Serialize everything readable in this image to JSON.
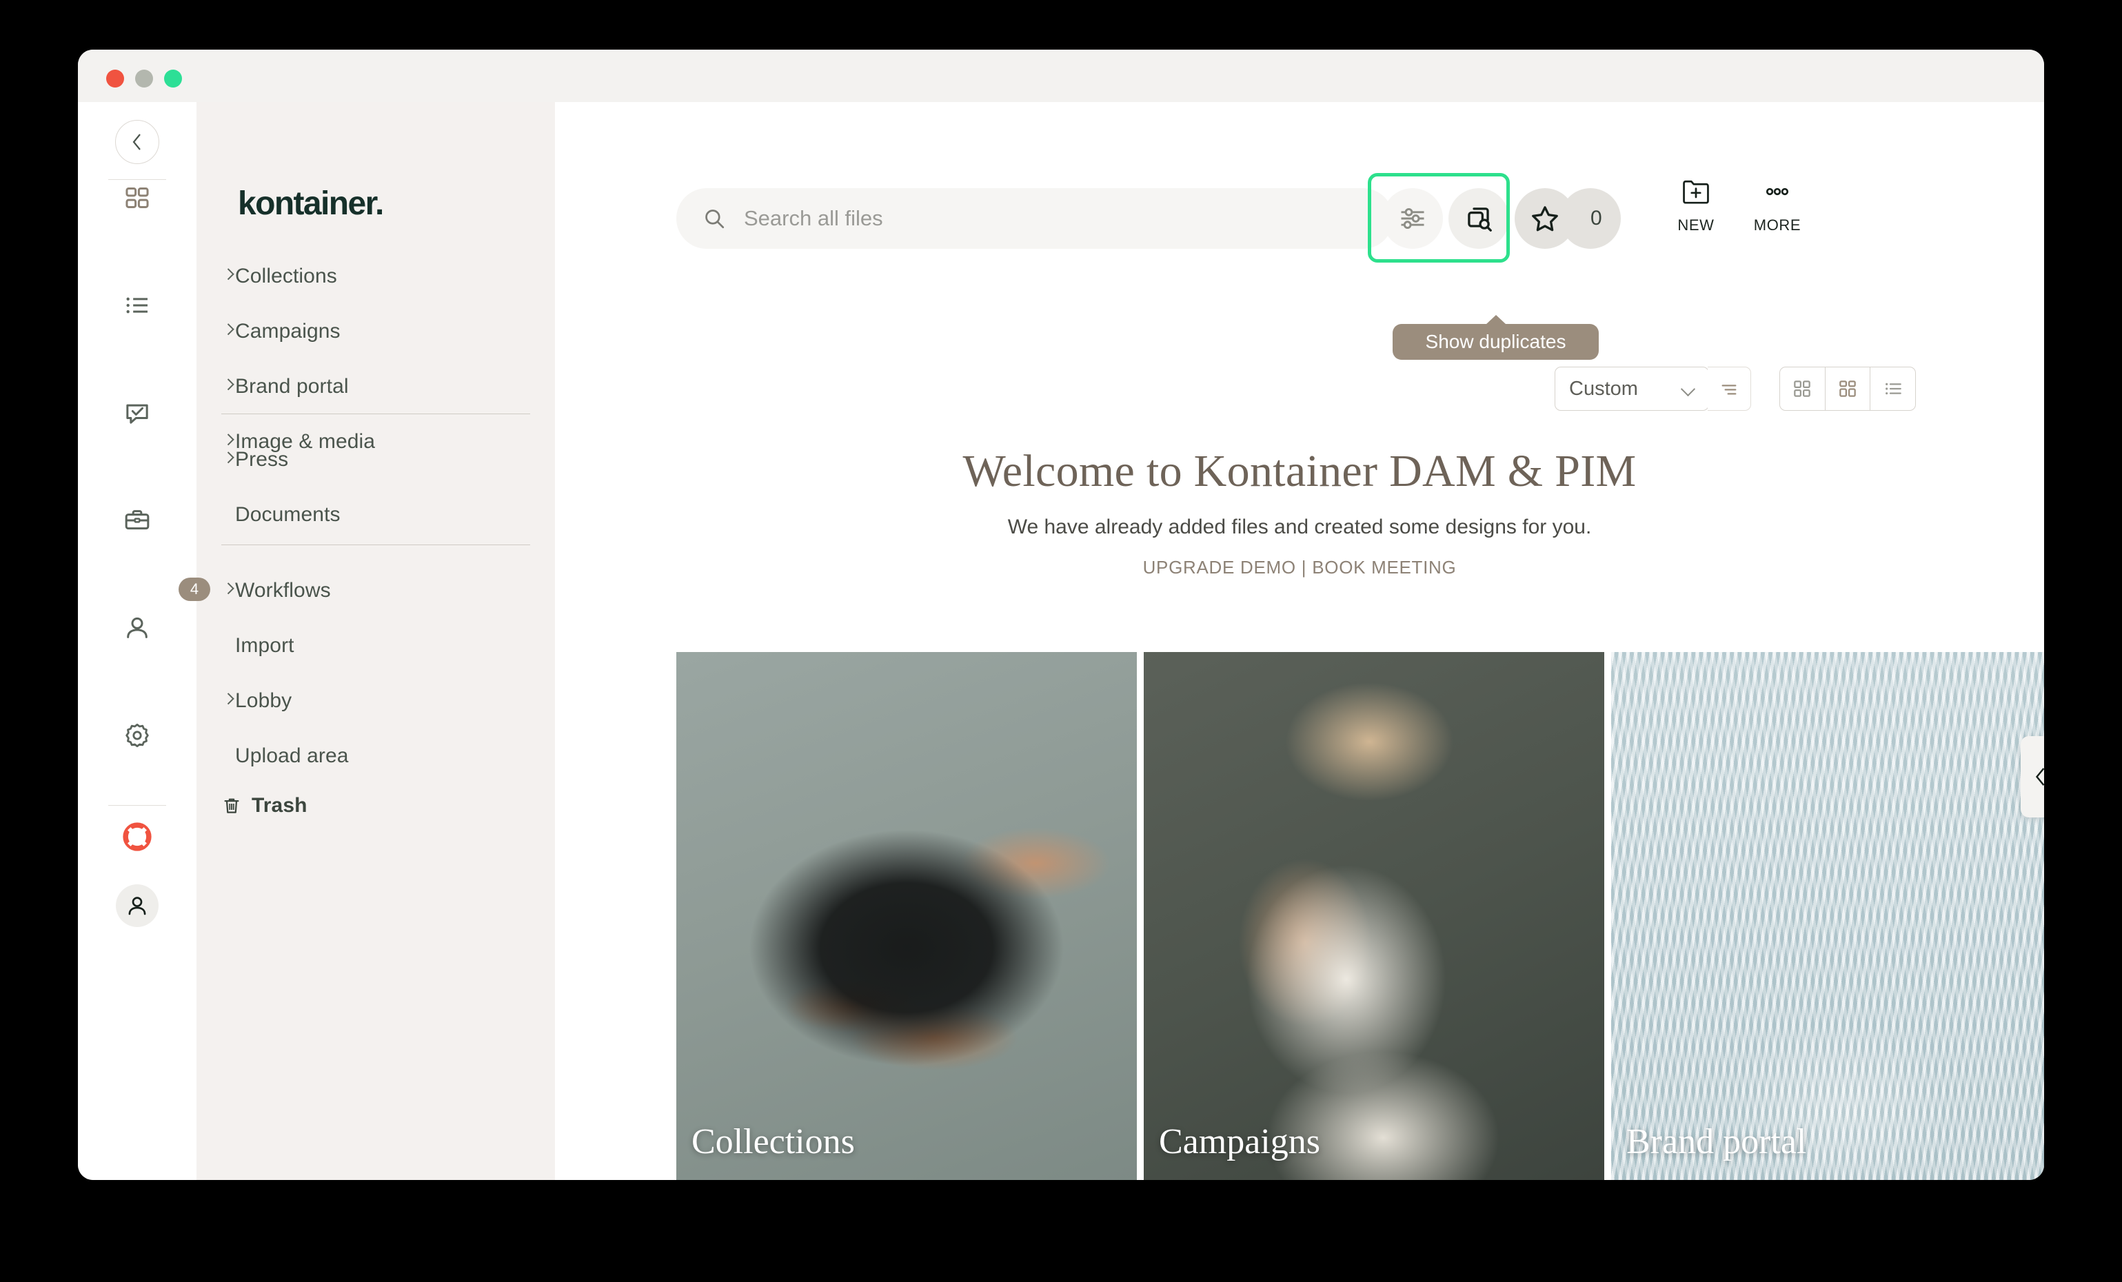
{
  "window": {
    "traffic_lights": [
      "close",
      "minimize",
      "zoom"
    ]
  },
  "brand": {
    "logo_text": "kontainer."
  },
  "rail": {
    "collapse_icon": "chevron-left-icon",
    "items": [
      {
        "icon": "grid-icon",
        "name": "dashboard"
      },
      {
        "icon": "list-icon",
        "name": "lists"
      },
      {
        "icon": "comment-check-icon",
        "name": "tasks",
        "badge": "4"
      },
      {
        "icon": "briefcase-icon",
        "name": "portals"
      },
      {
        "icon": "user-icon",
        "name": "users"
      },
      {
        "icon": "gear-icon",
        "name": "settings"
      }
    ],
    "support_icon": "life-ring-icon",
    "avatar_icon": "user-avatar-icon"
  },
  "sidebar": {
    "group1": [
      {
        "label": "Collections",
        "expandable": true
      },
      {
        "label": "Campaigns",
        "expandable": true
      },
      {
        "label": "Brand portal",
        "expandable": true
      },
      {
        "label": "Image & media",
        "expandable": true
      }
    ],
    "group2": [
      {
        "label": "Press",
        "expandable": true
      },
      {
        "label": "Documents",
        "expandable": false
      }
    ],
    "group3": [
      {
        "label": "Workflows",
        "expandable": true
      },
      {
        "label": "Import",
        "expandable": false
      },
      {
        "label": "Lobby",
        "expandable": true
      },
      {
        "label": "Upload area",
        "expandable": false
      }
    ],
    "trash": {
      "label": "Trash",
      "icon": "trash-icon"
    },
    "drag_handle": "resize-handle"
  },
  "toolbar": {
    "search": {
      "placeholder": "Search all files",
      "value": "",
      "icon": "search-icon"
    },
    "filter_button": {
      "icon": "sliders-icon",
      "name": "filters"
    },
    "duplicates_button": {
      "icon": "duplicate-search-icon",
      "name": "show-duplicates"
    },
    "favorites_button": {
      "icon": "star-icon",
      "name": "favorites"
    },
    "favorites_count": "0",
    "tooltip": "Show duplicates",
    "highlight_color": "#2de08c",
    "tooltip_color": "#9b8d7d",
    "new": {
      "label": "NEW",
      "icon": "folder-plus-icon"
    },
    "more": {
      "label": "MORE",
      "icon": "ellipsis-icon"
    }
  },
  "viewbar": {
    "sort_value": "Custom",
    "sort_chevron": "chevron-down-icon",
    "sort_direction_icon": "sort-descending-icon",
    "views": [
      {
        "icon": "grid-small-icon",
        "name": "grid-view",
        "active": false
      },
      {
        "icon": "grid-mixed-icon",
        "name": "masonry-view",
        "active": true
      },
      {
        "icon": "list-view-icon",
        "name": "list-view",
        "active": false
      }
    ]
  },
  "hero": {
    "title": "Welcome to Kontainer DAM & PIM",
    "subtitle": "We have already added files and created some designs for you.",
    "link_upgrade": "UPGRADE DEMO",
    "link_separator": "|",
    "link_meeting": "BOOK MEETING"
  },
  "cards": [
    {
      "caption": "Collections",
      "photo": "black-nike-sneakers-held-in-hand"
    },
    {
      "caption": "Campaigns",
      "photo": "blonde-model-in-white-outfit"
    },
    {
      "caption": "Brand portal",
      "photo": "oculus-transit-hall-interior"
    }
  ],
  "right_panel": {
    "toggle_icon": "chevron-left-icon",
    "name": "open-right-panel"
  }
}
